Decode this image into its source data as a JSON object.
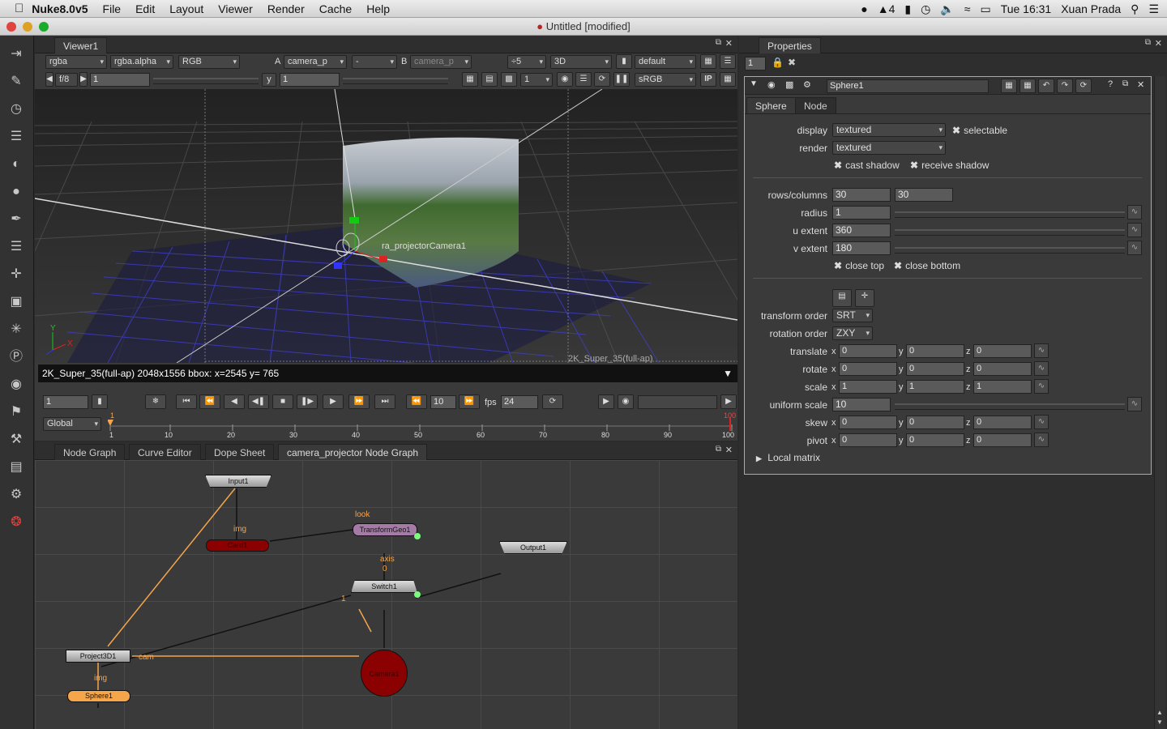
{
  "menubar": {
    "app": "Nuke8.0v5",
    "items": [
      "File",
      "Edit",
      "Layout",
      "Viewer",
      "Render",
      "Cache",
      "Help"
    ],
    "status_num": "4",
    "clock": "Tue 16:31",
    "user": "Xuan Prada"
  },
  "window": {
    "title": "Untitled [modified]"
  },
  "viewer": {
    "tab": "Viewer1",
    "channels": "rgba",
    "alpha": "rgba.alpha",
    "colorspace": "RGB",
    "a_label": "A",
    "a_input": "camera_p",
    "a_op": "-",
    "b_label": "B",
    "b_input": "camera_p",
    "downrez": "÷5",
    "mode": "3D",
    "lut_default": "default",
    "fstop": "f/8",
    "gain": "1",
    "y_label": "y",
    "gamma": "1",
    "proxy": "1",
    "view_lut": "sRGB",
    "ip": "IP",
    "overlay_label": "ra_projectorCamera1",
    "format_label": "2K_Super_35(full-ap)",
    "info": "2K_Super_35(full-ap) 2048x1556 bbox:  x=2545 y= 765",
    "axis_y": "Y",
    "axis_x": "X"
  },
  "timeline": {
    "frame": "1",
    "step": "10",
    "fps_label": "fps",
    "fps": "24",
    "range_mode": "Global",
    "ticks": [
      "10",
      "20",
      "30",
      "40",
      "50",
      "60",
      "70",
      "80",
      "90",
      "100"
    ],
    "start": "1",
    "start_top": "1",
    "end_top": "100"
  },
  "nodegraph": {
    "tabs": [
      "Node Graph",
      "Curve Editor",
      "Dope Sheet",
      "camera_projector Node Graph"
    ],
    "nodes": {
      "input": "Input1",
      "card": "Card1",
      "transform": "TransformGeo1",
      "output": "Output1",
      "switch": "Switch1",
      "camera": "Camera1",
      "project": "Project3D1",
      "sphere": "Sphere1"
    },
    "edge_labels": {
      "img1": "img",
      "look": "look",
      "axis": "axis",
      "zero": "0",
      "one": "1",
      "cam": "cam",
      "img2": "img"
    }
  },
  "properties": {
    "title": "Properties",
    "max_nodes": "1",
    "node_name": "Sphere1",
    "tabs": [
      "Sphere",
      "Node"
    ],
    "display_label": "display",
    "display": "textured",
    "selectable": "selectable",
    "render_label": "render",
    "render": "textured",
    "cast_shadow": "cast shadow",
    "receive_shadow": "receive shadow",
    "rows_label": "rows/columns",
    "rows": "30",
    "columns": "30",
    "radius_label": "radius",
    "radius": "1",
    "uext_label": "u extent",
    "uext": "360",
    "vext_label": "v extent",
    "vext": "180",
    "close_top": "close top",
    "close_bottom": "close bottom",
    "torder_label": "transform order",
    "torder": "SRT",
    "rorder_label": "rotation order",
    "rorder": "ZXY",
    "translate_label": "translate",
    "rotate_label": "rotate",
    "scale_label": "scale",
    "uscale_label": "uniform scale",
    "uscale": "10",
    "skew_label": "skew",
    "pivot_label": "pivot",
    "translate": [
      "0",
      "0",
      "0"
    ],
    "rotate": [
      "0",
      "0",
      "0"
    ],
    "scale": [
      "1",
      "1",
      "1"
    ],
    "skew": [
      "0",
      "0",
      "0"
    ],
    "pivot": [
      "0",
      "0",
      "0"
    ],
    "xyz": [
      "x",
      "y",
      "z"
    ],
    "local_matrix": "Local matrix"
  },
  "colors": {
    "bg": "#3a3a3a",
    "node_red": "#8b0000",
    "node_orange": "#f5a54a",
    "node_purple": "#a67aa6",
    "accent_orange": "#f5a54a"
  }
}
